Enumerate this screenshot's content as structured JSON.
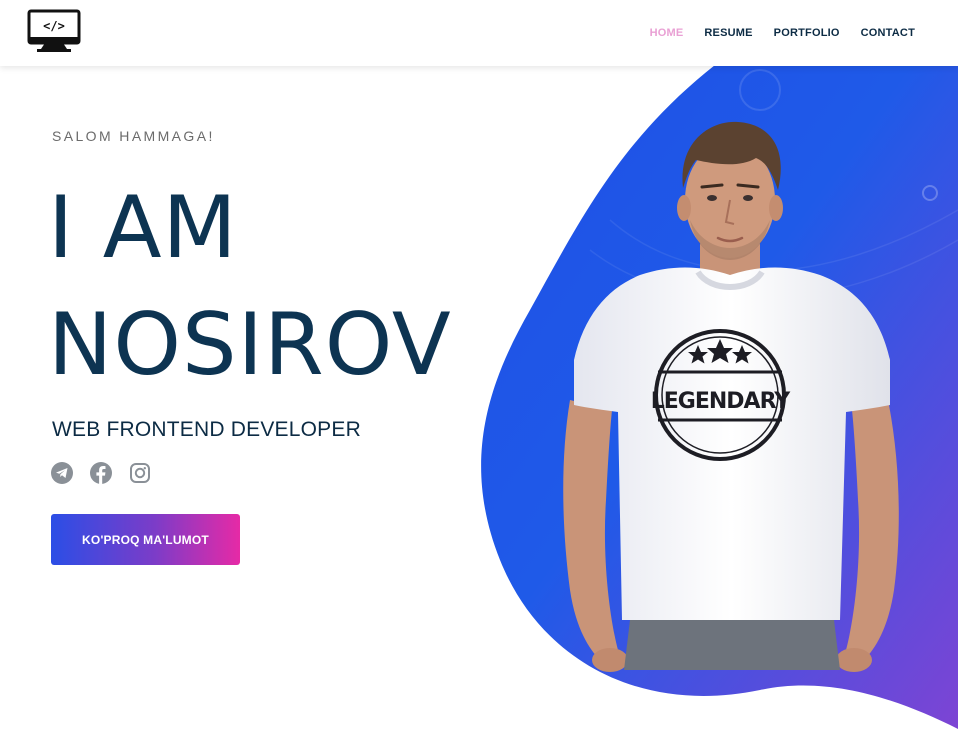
{
  "header": {
    "logo_icon": "code-monitor-icon",
    "nav": [
      {
        "label": "HOME",
        "active": true
      },
      {
        "label": "RESUME",
        "active": false
      },
      {
        "label": "PORTFOLIO",
        "active": false
      },
      {
        "label": "CONTACT",
        "active": false
      }
    ]
  },
  "hero": {
    "greeting": "SALOM HAMMAGA!",
    "title_line1": "I AM",
    "title_line2": "NOSIROV",
    "subtitle": "WEB FRONTEND DEVELOPER",
    "socials": [
      {
        "icon": "telegram-icon"
      },
      {
        "icon": "facebook-icon"
      },
      {
        "icon": "instagram-icon"
      }
    ],
    "cta_label": "KO'PROQ MA'LUMOT",
    "shirt_text": "LEGENDARY"
  },
  "colors": {
    "heading": "#0d3452",
    "nav_text": "#0c2b44",
    "nav_active": "#e9a0d4",
    "blob_start": "#1a55e3",
    "blob_end": "#8a3fd0",
    "cta_start": "#2b4ee6",
    "cta_end": "#e62aa6"
  }
}
